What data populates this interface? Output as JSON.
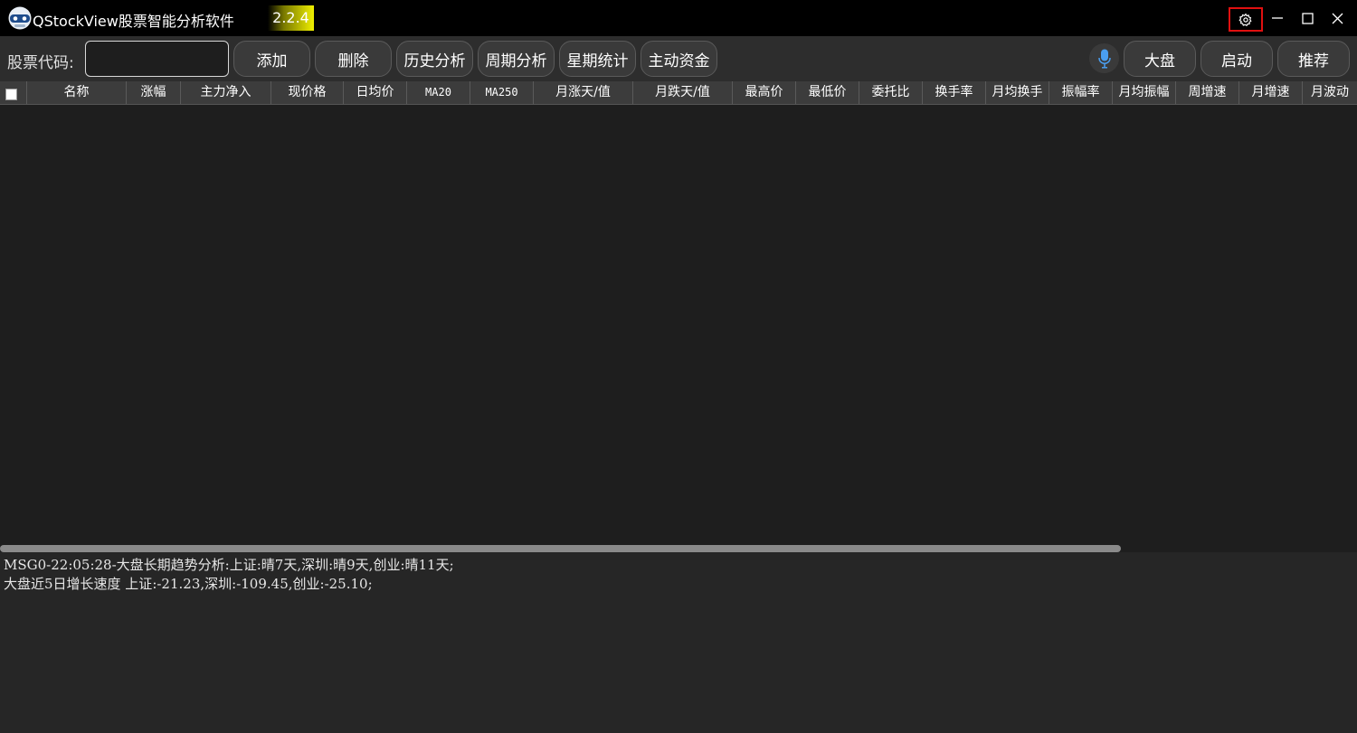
{
  "titlebar": {
    "app_title": "QStockView股票智能分析软件",
    "version": "2.2.4",
    "logo_icon": "robot-logo-icon",
    "settings_icon": "gear-icon",
    "minimize_icon": "minimize-icon",
    "maximize_icon": "maximize-icon",
    "close_icon": "close-icon"
  },
  "toolbar": {
    "code_label": "股票代码:",
    "code_input_value": "",
    "code_input_placeholder": "",
    "buttons_left": [
      "添加",
      "删除",
      "历史分析",
      "周期分析",
      "星期统计",
      "主动资金"
    ],
    "mic_icon": "microphone-icon",
    "buttons_right": [
      "大盘",
      "启动",
      "推荐"
    ]
  },
  "table": {
    "columns": [
      "名称",
      "涨幅",
      "主力净入",
      "现价格",
      "日均价",
      "MA20",
      "MA250",
      "月涨天/值",
      "月跌天/值",
      "最高价",
      "最低价",
      "委托比",
      "换手率",
      "月均换手",
      "振幅率",
      "月均振幅",
      "周增速",
      "月增速",
      "月波动"
    ],
    "rows": []
  },
  "log": {
    "lines": [
      "MSG0-22:05:28-大盘长期趋势分析:上证:晴7天,深圳:晴9天,创业:晴11天;",
      "大盘近5日增长速度 上证:-21.23,深圳:-109.45,创业:-25.10;"
    ]
  },
  "colors": {
    "titlebar_bg": "#000000",
    "toolbar_bg": "#2d2d2d",
    "button_bg": "#3a3a3a",
    "header_bg": "#3c3c3c",
    "body_bg": "#1e1e1e",
    "log_bg": "#262626",
    "mic_accent": "#4a9ef0",
    "settings_highlight": "#e01010"
  }
}
